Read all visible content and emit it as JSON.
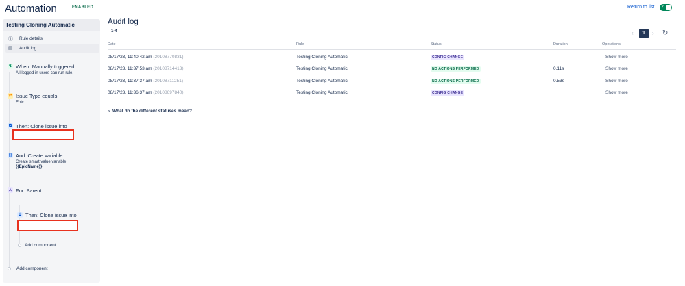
{
  "header": {
    "title": "Automation",
    "status_badge": "ENABLED",
    "return_link": "Return to list",
    "toggle_state": "on"
  },
  "sidebar": {
    "rule_name": "Testing Cloning Automatic",
    "nav": [
      {
        "label": "Rule details",
        "icon": "info-icon"
      },
      {
        "label": "Audit log",
        "icon": "document-icon"
      }
    ],
    "components": [
      {
        "title": "When: Manually triggered",
        "subtitle": "All logged in users can run rule.",
        "icon": "trigger-icon"
      },
      {
        "title": "Issue Type equals",
        "subtitle": "Epic",
        "icon": "condition-icon"
      },
      {
        "title": "Then: Clone issue into",
        "icon": "clone-icon"
      },
      {
        "title": "And: Create variable",
        "subtitle": "Create smart value variable",
        "subtitle2": "{{EpicName}}",
        "icon": "variable-icon"
      },
      {
        "title": "For: Parent",
        "icon": "branch-icon"
      },
      {
        "title": "Then: Clone issue into",
        "icon": "clone-icon"
      }
    ],
    "add_component_inner": "Add component",
    "add_component_outer": "Add component"
  },
  "main": {
    "title": "Audit log",
    "range": "1-4",
    "pagination": {
      "current": "1",
      "prev_icon": "chevron-left-icon",
      "next_icon": "chevron-right-icon"
    },
    "columns": [
      "Date",
      "Rule",
      "Status",
      "Duration",
      "Operations"
    ],
    "rows": [
      {
        "date": "08/17/23, 11:40:42 am",
        "id": "(20108770831)",
        "rule": "Testing Cloning Automatic",
        "status": "CONFIG CHANGE",
        "duration": "",
        "ops": "Show more"
      },
      {
        "date": "08/17/23, 11:37:53 am",
        "id": "(20108714413)",
        "rule": "Testing Cloning Automatic",
        "status": "NO ACTIONS PERFORMED",
        "duration": "0.11s",
        "ops": "Show more"
      },
      {
        "date": "08/17/23, 11:37:37 am",
        "id": "(20108711251)",
        "rule": "Testing Cloning Automatic",
        "status": "NO ACTIONS PERFORMED",
        "duration": "0.53s",
        "ops": "Show more"
      },
      {
        "date": "08/17/23, 11:36:37 am",
        "id": "(20108697840)",
        "rule": "Testing Cloning Automatic",
        "status": "CONFIG CHANGE",
        "duration": "",
        "ops": "Show more"
      }
    ],
    "faq": "What do the different statuses mean?"
  },
  "colors": {
    "accent": "#0052cc",
    "enabled_green": "#00875a",
    "config_change": "#403294",
    "no_actions": "#006644",
    "redaction_box": "#e8321f"
  }
}
